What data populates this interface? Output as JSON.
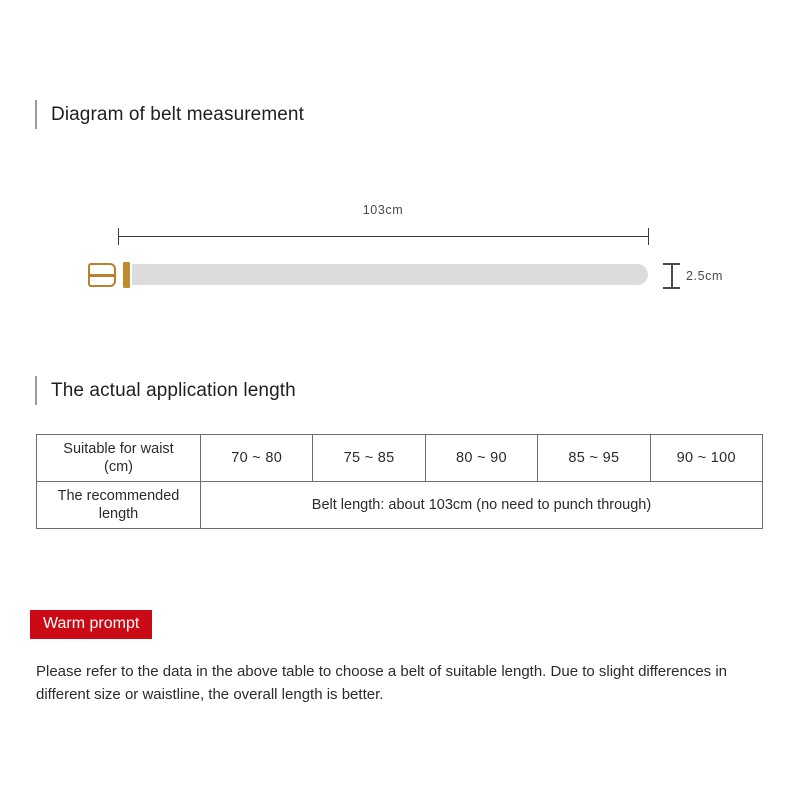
{
  "sections": {
    "diagram": {
      "heading": "Diagram of belt measurement"
    },
    "application": {
      "heading": "The actual application length"
    }
  },
  "belt_diagram": {
    "length_label": "103cm",
    "height_label": "2.5cm",
    "strap_color": "#dcdcdc",
    "buckle_color": "#b8812c",
    "dimension_line_color": "#3a3a3a"
  },
  "size_table": {
    "rows": [
      {
        "label": "Suitable for waist\n(cm)",
        "label_line1": "Suitable for waist",
        "label_line2": "(cm)",
        "values": [
          "70 ~ 80",
          "75 ~ 85",
          "80 ~ 90",
          "85 ~ 95",
          "90 ~ 100"
        ]
      },
      {
        "label_line1": "The recommended",
        "label_line2": "length",
        "merged_value": "Belt length: about 103cm (no need to punch through)"
      }
    ]
  },
  "warm_prompt": {
    "badge_label": "Warm prompt",
    "badge_color": "#cc0a16",
    "body": "Please refer to the data in the above table to choose a belt of suitable length. Due to slight differences in different size or waistline, the overall length is better."
  }
}
